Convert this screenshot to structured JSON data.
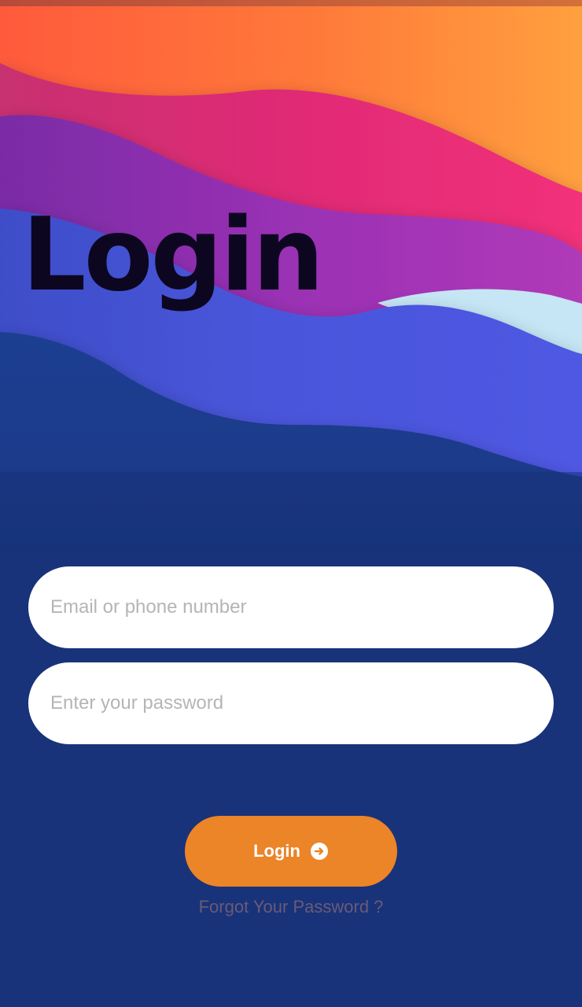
{
  "header": {
    "title": "Login"
  },
  "form": {
    "email": {
      "placeholder": "Email or phone number",
      "value": ""
    },
    "password": {
      "placeholder": "Enter your password",
      "value": ""
    },
    "submit": {
      "label": "Login",
      "icon": "arrow-right-circle-icon"
    },
    "forgot_link": "Forgot Your Password ?"
  },
  "colors": {
    "background": "#18337a",
    "accent": "#ec8428",
    "title": "#0d0620",
    "forgot_text": "#6a5a78",
    "placeholder": "#b5b5b5"
  }
}
